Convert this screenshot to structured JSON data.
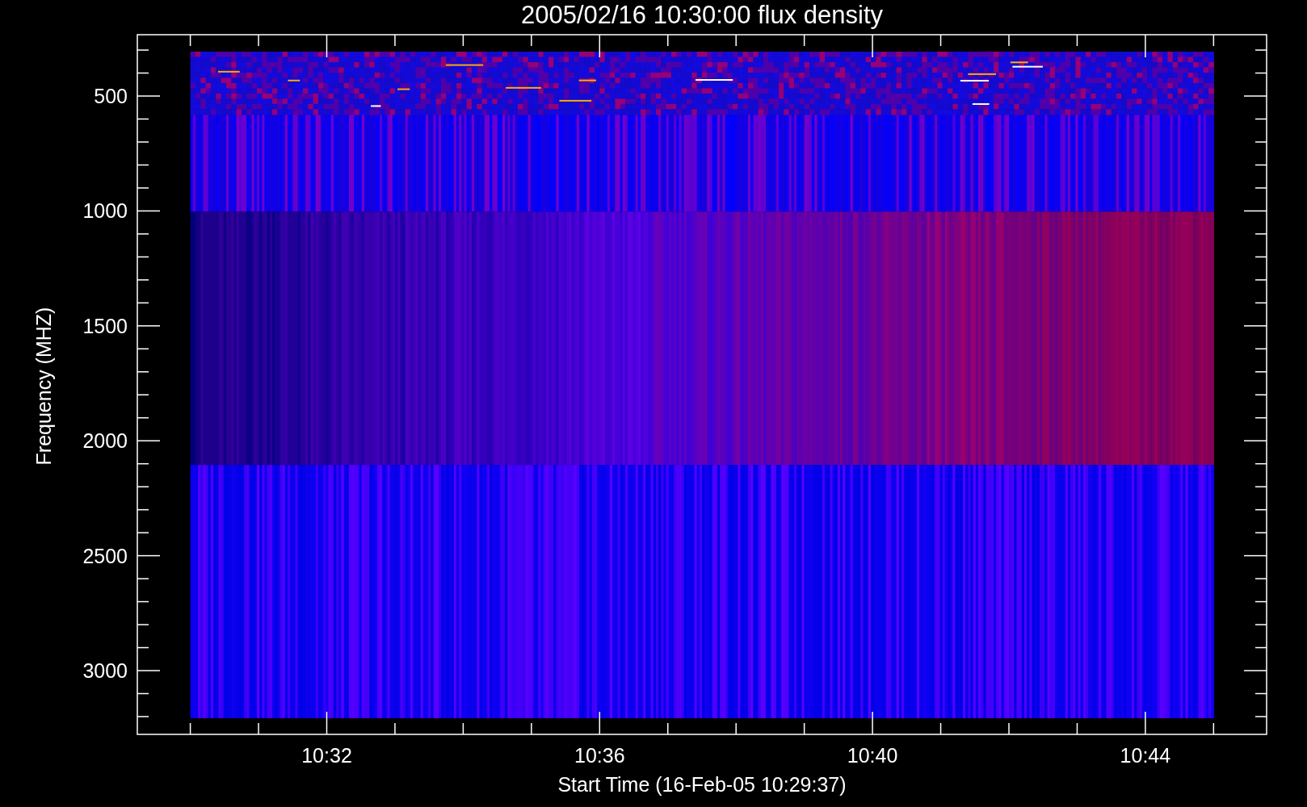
{
  "title": "2005/02/16 10:30:00 flux density",
  "chart": {
    "xlabel": "Start Time (16-Feb-05 10:29:37)",
    "ylabel": "Frequency (MHZ)",
    "xticks": [
      "10:32",
      "10:36",
      "10:40",
      "10:44"
    ],
    "yticks": [
      "500",
      "1000",
      "1500",
      "2000",
      "2500",
      "3000"
    ]
  }
}
